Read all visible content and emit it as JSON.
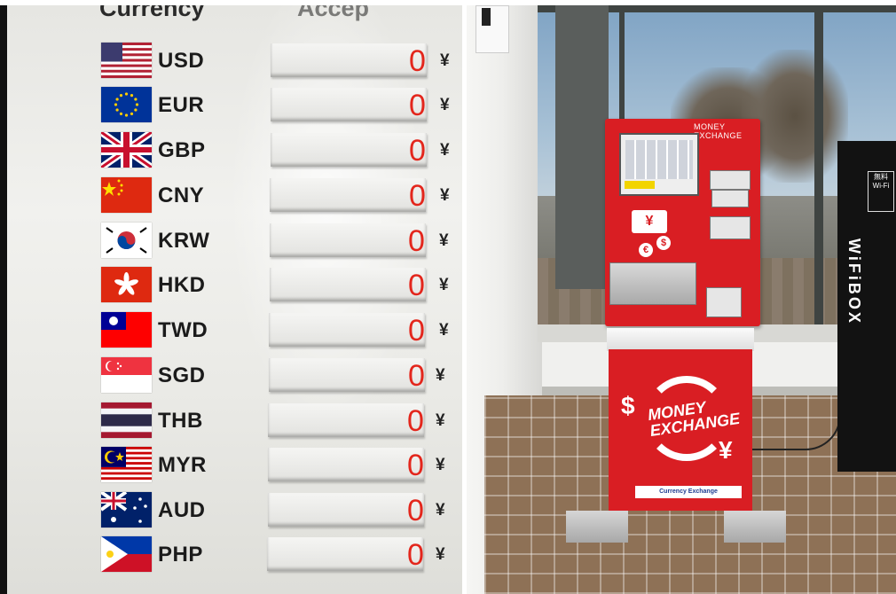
{
  "screen": {
    "header": {
      "currency": "Currency",
      "accept": "Accep"
    },
    "rows": [
      {
        "code": "USD",
        "flag": "us-flag-icon",
        "amount": "0",
        "unit": "¥"
      },
      {
        "code": "EUR",
        "flag": "eu-flag-icon",
        "amount": "0",
        "unit": "¥"
      },
      {
        "code": "GBP",
        "flag": "uk-flag-icon",
        "amount": "0",
        "unit": "¥"
      },
      {
        "code": "CNY",
        "flag": "china-flag-icon",
        "amount": "0",
        "unit": "¥"
      },
      {
        "code": "KRW",
        "flag": "korea-flag-icon",
        "amount": "0",
        "unit": "¥"
      },
      {
        "code": "HKD",
        "flag": "hong-kong-flag-icon",
        "amount": "0",
        "unit": "¥"
      },
      {
        "code": "TWD",
        "flag": "taiwan-flag-icon",
        "amount": "0",
        "unit": "¥"
      },
      {
        "code": "SGD",
        "flag": "singapore-flag-icon",
        "amount": "0",
        "unit": "¥"
      },
      {
        "code": "THB",
        "flag": "thailand-flag-icon",
        "amount": "0",
        "unit": "¥"
      },
      {
        "code": "MYR",
        "flag": "malaysia-flag-icon",
        "amount": "0",
        "unit": "¥"
      },
      {
        "code": "AUD",
        "flag": "australia-flag-icon",
        "amount": "0",
        "unit": "¥"
      },
      {
        "code": "PHP",
        "flag": "philippines-flag-icon",
        "amount": "0",
        "unit": "¥"
      }
    ],
    "colors": {
      "amount": "#e3261c",
      "text": "#1b1b1b",
      "background": "#eaeae6"
    }
  },
  "photo": {
    "kiosk": {
      "title": "MONEY EXCHANGE",
      "body_line1": "MONEY",
      "body_line2": "EXCHANGE",
      "footer": "Currency Exchange",
      "color": "#d91e23"
    },
    "wifi_box": {
      "label": "WiFiBOX",
      "tag": "無料 Wi-Fi"
    }
  }
}
